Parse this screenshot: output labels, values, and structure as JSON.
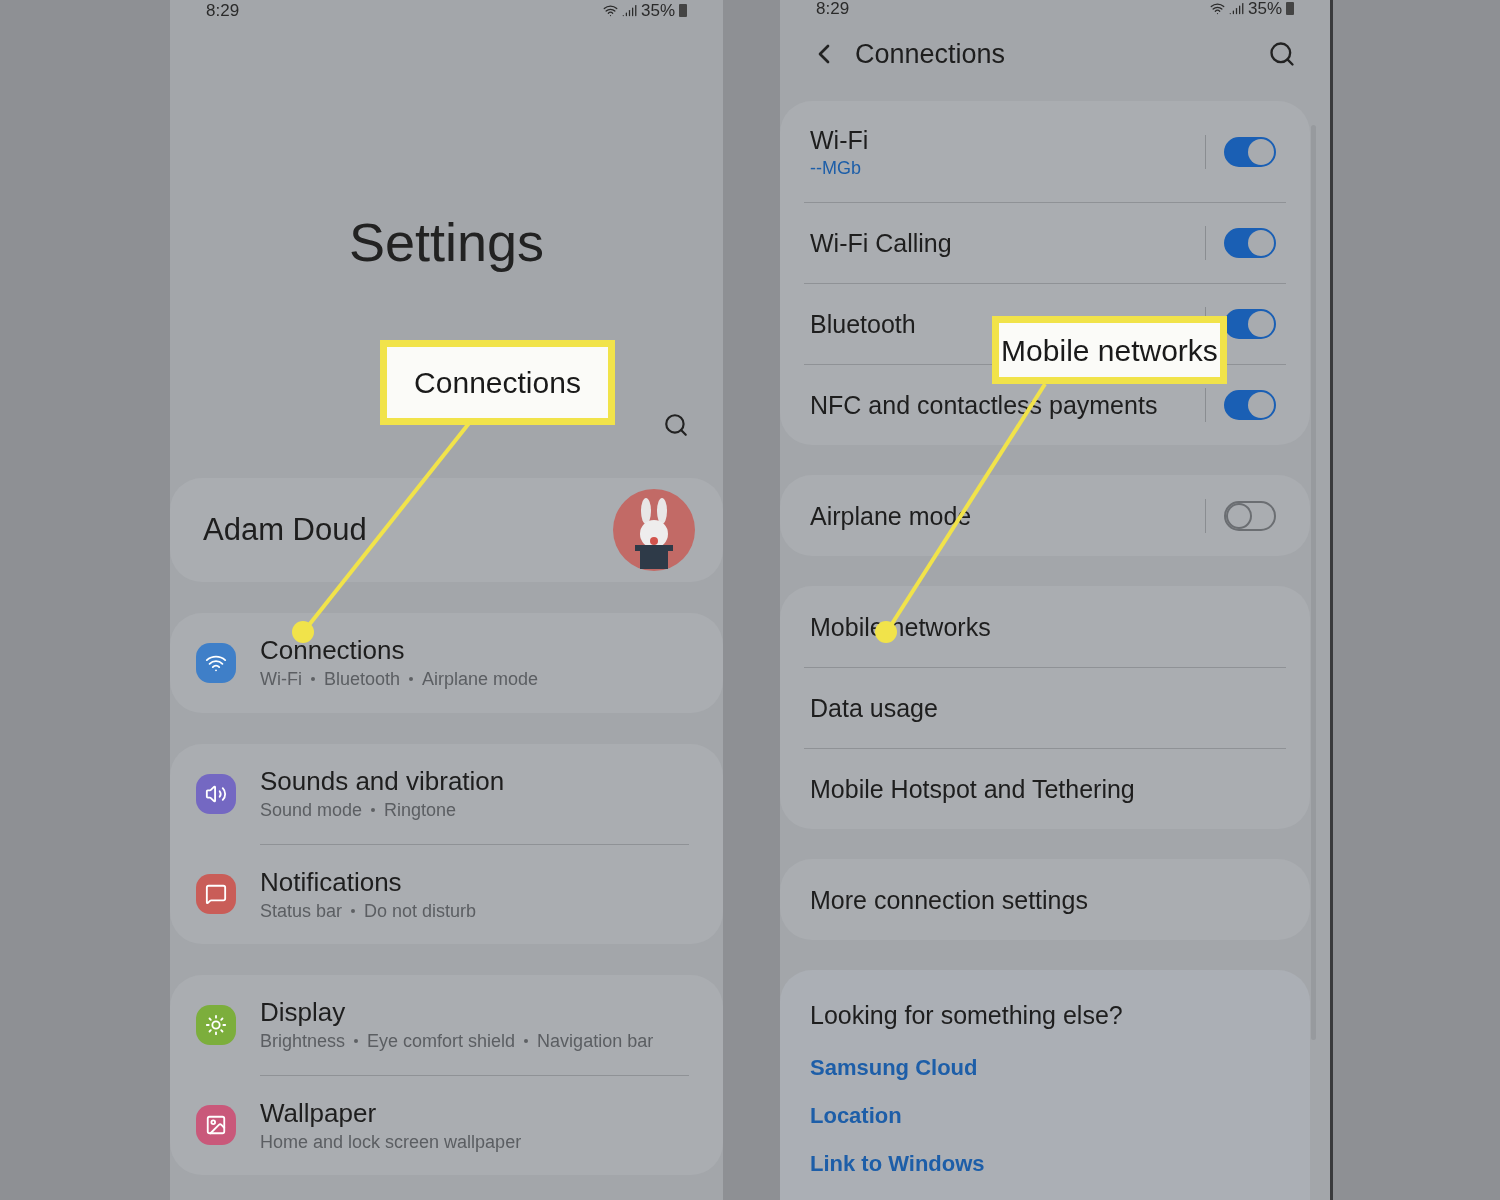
{
  "left_screen": {
    "status_bar": {
      "time": "8:29",
      "battery": "35%"
    },
    "title": "Settings",
    "profile": {
      "name": "Adam Doud"
    },
    "groups": [
      [
        {
          "kind": "wifi",
          "title": "Connections",
          "subtitle": [
            "Wi-Fi",
            "Bluetooth",
            "Airplane mode"
          ]
        }
      ],
      [
        {
          "kind": "sound",
          "title": "Sounds and vibration",
          "subtitle": [
            "Sound mode",
            "Ringtone"
          ]
        },
        {
          "kind": "notification",
          "title": "Notifications",
          "subtitle": [
            "Status bar",
            "Do not disturb"
          ]
        }
      ],
      [
        {
          "kind": "display",
          "title": "Display",
          "subtitle": [
            "Brightness",
            "Eye comfort shield",
            "Navigation bar"
          ]
        },
        {
          "kind": "wallpaper",
          "title": "Wallpaper",
          "subtitle": [
            "Home and lock screen wallpaper"
          ]
        }
      ]
    ],
    "callout": {
      "text": "Connections"
    }
  },
  "right_screen": {
    "status_bar": {
      "time": "8:29",
      "battery": "35%"
    },
    "title": "Connections",
    "groups": [
      [
        {
          "title": "Wi-Fi",
          "subtitle": "--MGb",
          "on": true
        },
        {
          "title": "Wi-Fi Calling",
          "on": true
        },
        {
          "title": "Bluetooth",
          "on": true
        },
        {
          "title": "NFC and contactless payments",
          "on": true
        }
      ],
      [
        {
          "title": "Airplane mode",
          "on": false
        }
      ],
      [
        {
          "title": "Mobile networks"
        },
        {
          "title": "Data usage"
        },
        {
          "title": "Mobile Hotspot and Tethering"
        }
      ],
      [
        {
          "title": "More connection settings"
        }
      ]
    ],
    "suggestions": {
      "heading": "Looking for something else?",
      "links": [
        "Samsung Cloud",
        "Location",
        "Link to Windows"
      ]
    },
    "callout": {
      "text": "Mobile networks"
    }
  }
}
